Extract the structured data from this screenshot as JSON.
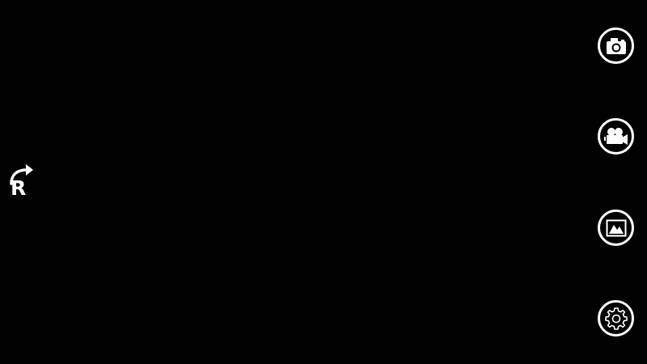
{
  "rotate": {
    "letter": "R",
    "icon": "rotate-arrow-icon"
  },
  "controls": [
    {
      "id": "photo",
      "icon": "camera-icon"
    },
    {
      "id": "video",
      "icon": "video-camera-icon"
    },
    {
      "id": "gallery",
      "icon": "gallery-icon"
    },
    {
      "id": "settings",
      "icon": "gear-icon"
    }
  ],
  "colors": {
    "background": "#000000",
    "foreground": "#ffffff"
  }
}
